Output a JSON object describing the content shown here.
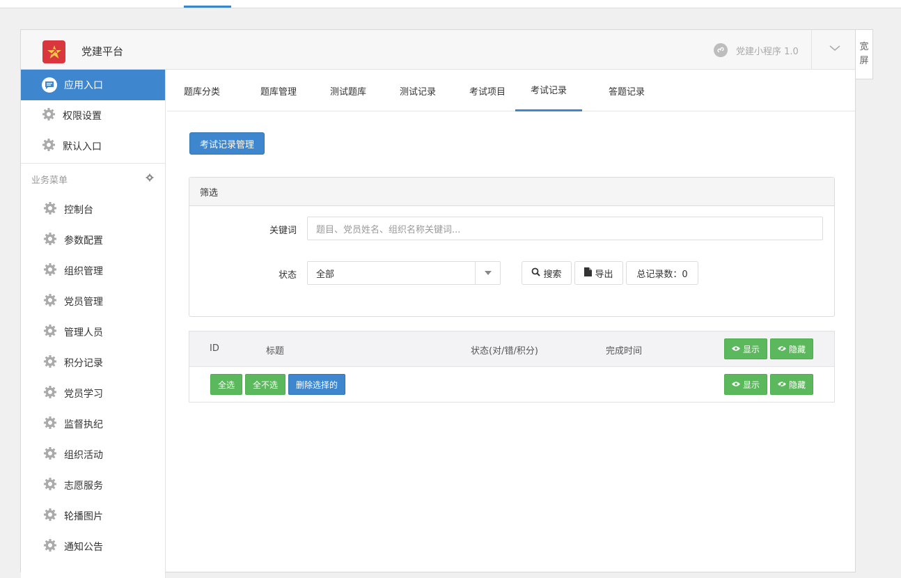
{
  "header": {
    "brand": "党建平台",
    "app_name": "党建小程序 1.0",
    "wide_screen": [
      "宽",
      "屏"
    ]
  },
  "sidebar": {
    "top_items": [
      {
        "label": "应用入口",
        "active": true
      },
      {
        "label": "权限设置"
      },
      {
        "label": "默认入口"
      }
    ],
    "section_title": "业务菜单",
    "sub_items": [
      "控制台",
      "参数配置",
      "组织管理",
      "党员管理",
      "管理人员",
      "积分记录",
      "党员学习",
      "监督执纪",
      "组织活动",
      "志愿服务",
      "轮播图片",
      "通知公告"
    ]
  },
  "tabs": [
    "题库分类",
    "题库管理",
    "测试题库",
    "测试记录",
    "考试项目",
    "考试记录",
    "答题记录"
  ],
  "active_tab": "考试记录",
  "main": {
    "manage_button": "考试记录管理",
    "filter_title": "筛选",
    "keyword_label": "关键词",
    "keyword_placeholder": "题目、党员姓名、组织名称关键词...",
    "status_label": "状态",
    "status_value": "全部",
    "search_button": "搜索",
    "export_button": "导出",
    "total_label": "总记录数：0"
  },
  "table": {
    "columns": [
      "ID",
      "标题",
      "状态(对/错/积分)",
      "完成时间"
    ],
    "show_button": "显示",
    "hide_button": "隐藏",
    "select_all": "全选",
    "select_none": "全不选",
    "delete_selected": "删除选择的"
  },
  "colors": {
    "accent": "#3e86cd",
    "success": "#5cb85c",
    "brand_red": "#d9363e"
  }
}
